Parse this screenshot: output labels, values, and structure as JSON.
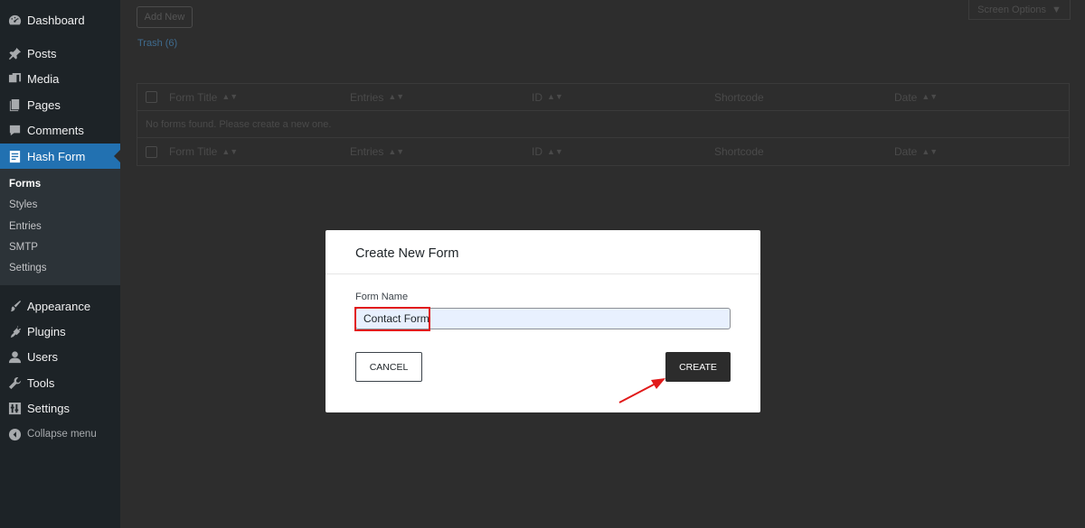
{
  "sidebar": {
    "items": [
      {
        "label": "Dashboard",
        "icon": "dashboard-icon"
      },
      {
        "label": "Posts",
        "icon": "pin-icon"
      },
      {
        "label": "Media",
        "icon": "media-icon"
      },
      {
        "label": "Pages",
        "icon": "pages-icon"
      },
      {
        "label": "Comments",
        "icon": "comment-icon"
      },
      {
        "label": "Hash Form",
        "icon": "form-icon"
      },
      {
        "label": "Appearance",
        "icon": "brush-icon"
      },
      {
        "label": "Plugins",
        "icon": "plugin-icon"
      },
      {
        "label": "Users",
        "icon": "user-icon"
      },
      {
        "label": "Tools",
        "icon": "wrench-icon"
      },
      {
        "label": "Settings",
        "icon": "settings-icon"
      }
    ],
    "submenu": [
      "Forms",
      "Styles",
      "Entries",
      "SMTP",
      "Settings"
    ],
    "collapse_label": "Collapse menu"
  },
  "content": {
    "add_new_label": "Add New",
    "screen_options_label": "Screen Options",
    "trash_label": "Trash (6)",
    "table": {
      "columns": [
        "Form Title",
        "Entries",
        "ID",
        "Shortcode",
        "Date"
      ],
      "empty_message": "No forms found. Please create a new one."
    }
  },
  "modal": {
    "title": "Create New Form",
    "field_label": "Form Name",
    "field_value": "Contact Form",
    "cancel_label": "CANCEL",
    "create_label": "CREATE"
  },
  "colors": {
    "active_menu": "#2271b1",
    "highlight": "#e11a1a",
    "create_button": "#2c2c2c"
  }
}
